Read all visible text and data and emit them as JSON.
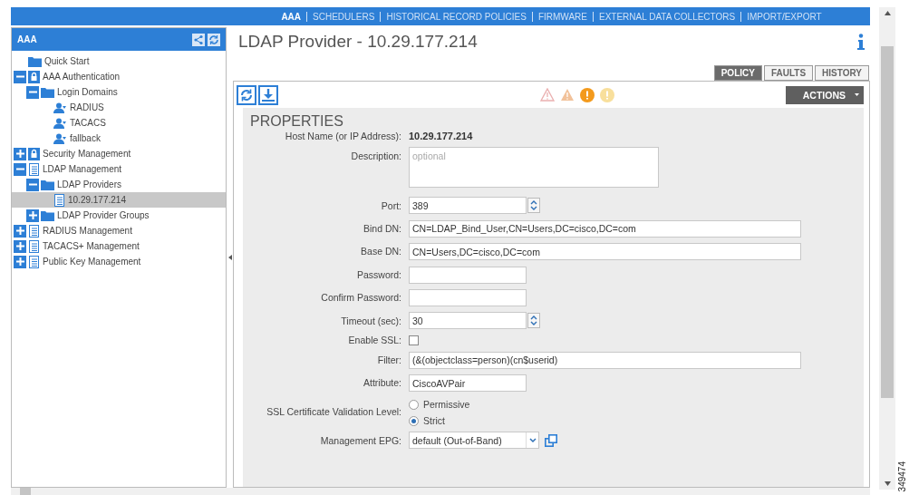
{
  "top_nav": [
    {
      "label": "AAA",
      "selected": true
    },
    {
      "label": "SCHEDULERS",
      "selected": false
    },
    {
      "label": "HISTORICAL RECORD POLICIES",
      "selected": false
    },
    {
      "label": "FIRMWARE",
      "selected": false
    },
    {
      "label": "EXTERNAL DATA COLLECTORS",
      "selected": false
    },
    {
      "label": "IMPORT/EXPORT",
      "selected": false
    }
  ],
  "sidebar": {
    "title": "AAA",
    "tree": [
      {
        "label": "Quick Start",
        "kind": "folder",
        "selected": false
      },
      {
        "label": "AAA Authentication",
        "kind": "lock",
        "expanded": true,
        "selected": false,
        "children": [
          {
            "label": "Login Domains",
            "kind": "folder",
            "expanded": true,
            "selected": false,
            "children": [
              {
                "label": "RADIUS",
                "kind": "user",
                "selected": false
              },
              {
                "label": "TACACS",
                "kind": "user",
                "selected": false
              },
              {
                "label": "fallback",
                "kind": "user",
                "selected": false
              }
            ]
          }
        ]
      },
      {
        "label": "Security Management",
        "kind": "lock",
        "expanded": false,
        "selected": false
      },
      {
        "label": "LDAP Management",
        "kind": "doc",
        "expanded": true,
        "selected": false,
        "children": [
          {
            "label": "LDAP Providers",
            "kind": "folder",
            "expanded": true,
            "selected": false,
            "children": [
              {
                "label": "10.29.177.214",
                "kind": "doc",
                "selected": true
              }
            ]
          },
          {
            "label": "LDAP Provider Groups",
            "kind": "folder",
            "expanded": false,
            "selected": false
          }
        ]
      },
      {
        "label": "RADIUS Management",
        "kind": "doc",
        "expanded": false,
        "selected": false
      },
      {
        "label": "TACACS+ Management",
        "kind": "doc",
        "expanded": false,
        "selected": false
      },
      {
        "label": "Public Key Management",
        "kind": "doc",
        "expanded": false,
        "selected": false
      }
    ]
  },
  "page": {
    "title": "LDAP Provider - 10.29.177.214"
  },
  "tabs": [
    {
      "label": "POLICY",
      "selected": true
    },
    {
      "label": "FAULTS",
      "selected": false
    },
    {
      "label": "HISTORY",
      "selected": false
    }
  ],
  "actions_button": "ACTIONS",
  "properties": {
    "heading": "PROPERTIES",
    "fields": [
      {
        "kind": "static",
        "label": "Host Name (or IP Address):",
        "value": "10.29.177.214"
      },
      {
        "kind": "textarea",
        "label": "Description:",
        "placeholder": "optional"
      },
      {
        "kind": "spinner",
        "label": "Port:",
        "value": "389"
      },
      {
        "kind": "long_text",
        "label": "Bind DN:",
        "value": "CN=LDAP_Bind_User,CN=Users,DC=cisco,DC=com"
      },
      {
        "kind": "long_text",
        "label": "Base DN:",
        "value": "CN=Users,DC=cisco,DC=com"
      },
      {
        "kind": "text",
        "label": "Password:"
      },
      {
        "kind": "text",
        "label": "Confirm Password:"
      },
      {
        "kind": "spinner",
        "label": "Timeout (sec):",
        "value": "30"
      },
      {
        "kind": "checkbox",
        "label": "Enable SSL:",
        "checked": false
      },
      {
        "kind": "long_text",
        "label": "Filter:",
        "value": "(&(objectclass=person)(cn$userid)"
      },
      {
        "kind": "text",
        "label": "Attribute:",
        "value": "CiscoAVPair"
      },
      {
        "kind": "radio",
        "label": "SSL Certificate Validation Level:",
        "options": [
          {
            "label": "Permissive",
            "selected": false
          },
          {
            "label": "Strict",
            "selected": true
          }
        ]
      },
      {
        "kind": "select",
        "label": "Management EPG:",
        "value": "default (Out-of-Band)"
      }
    ]
  },
  "figure_id": "349474"
}
